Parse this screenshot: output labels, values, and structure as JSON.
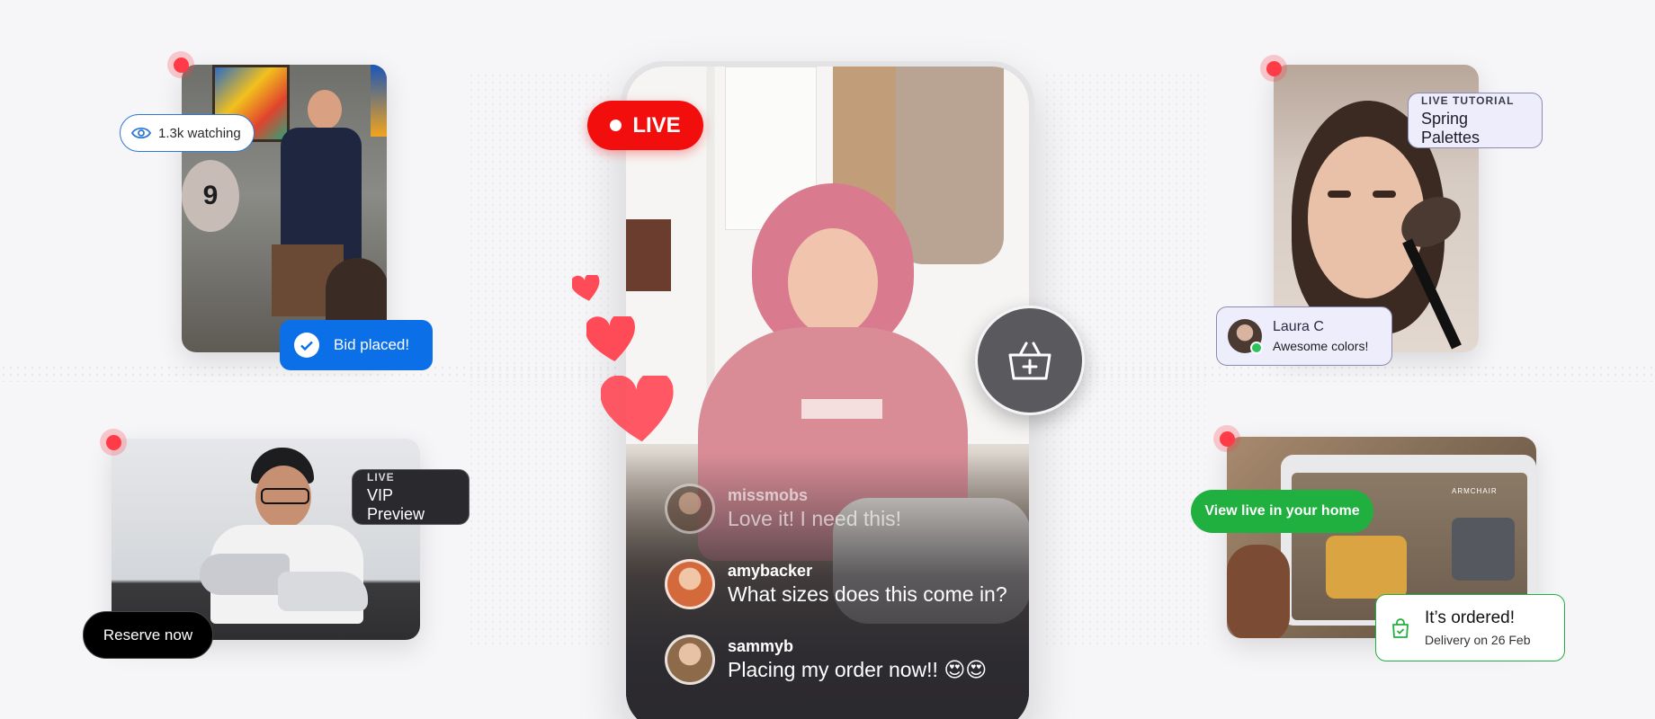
{
  "colors": {
    "live_red": "#f30e0e",
    "rec_red": "#ff3b47",
    "bid_blue": "#0b6fe8",
    "green": "#20b040",
    "dark_badge": "#2a2a2e",
    "heart": "#ff4a58"
  },
  "cards": {
    "auction": {
      "watching_label": "1.3k watching",
      "paddle_number": "9",
      "bid_label": "Bid placed!"
    },
    "sneaker": {
      "badge_kicker": "LIVE",
      "badge_title": "VIP Preview",
      "reserve_label": "Reserve now"
    },
    "makeup": {
      "badge_kicker": "LIVE TUTORIAL",
      "badge_title": "Spring Palettes",
      "comment_name": "Laura C",
      "comment_text": "Awesome colors!"
    },
    "furniture": {
      "view_label": "View live in your home",
      "screen_label": "ARMCHAIR",
      "order_title": "It’s ordered!",
      "order_subtitle": "Delivery on 26 Feb"
    }
  },
  "phone": {
    "live_label": "LIVE",
    "cart_icon": "basket-plus-icon",
    "chat": [
      {
        "user": "missmobs",
        "message": "Love it! I need this!"
      },
      {
        "user": "amybacker",
        "message": "What sizes does this come in?"
      },
      {
        "user": "sammyb",
        "message": "Placing my order now!! 😍😍"
      }
    ]
  }
}
